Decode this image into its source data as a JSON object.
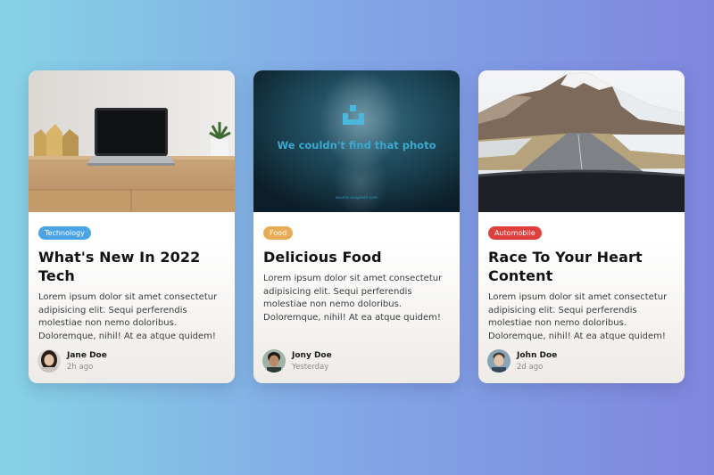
{
  "colors": {
    "technology_tag": "#4aa3e4",
    "food_tag": "#e9ab58",
    "automobile_tag": "#e0403d"
  },
  "cards": [
    {
      "tag": "Technology",
      "title": "What's New In 2022 Tech",
      "description": "Lorem ipsum dolor sit amet consectetur adipisicing elit. Sequi perferendis molestiae non nemo doloribus. Doloremque, nihil! At ea atque quidem!",
      "author": "Jane Doe",
      "time": "2h ago"
    },
    {
      "tag": "Food",
      "title": "Delicious Food",
      "description": "Lorem ipsum dolor sit amet consectetur adipisicing elit. Sequi perferendis molestiae non nemo doloribus. Doloremque, nihil! At ea atque quidem!",
      "author": "Jony Doe",
      "time": "Yesterday",
      "image_placeholder": "We couldn't find that photo",
      "image_source": "source.unsplash.com"
    },
    {
      "tag": "Automobile",
      "title": "Race To Your Heart Content",
      "description": "Lorem ipsum dolor sit amet consectetur adipisicing elit. Sequi perferendis molestiae non nemo doloribus. Doloremque, nihil! At ea atque quidem!",
      "author": "John Doe",
      "time": "2d ago"
    }
  ]
}
